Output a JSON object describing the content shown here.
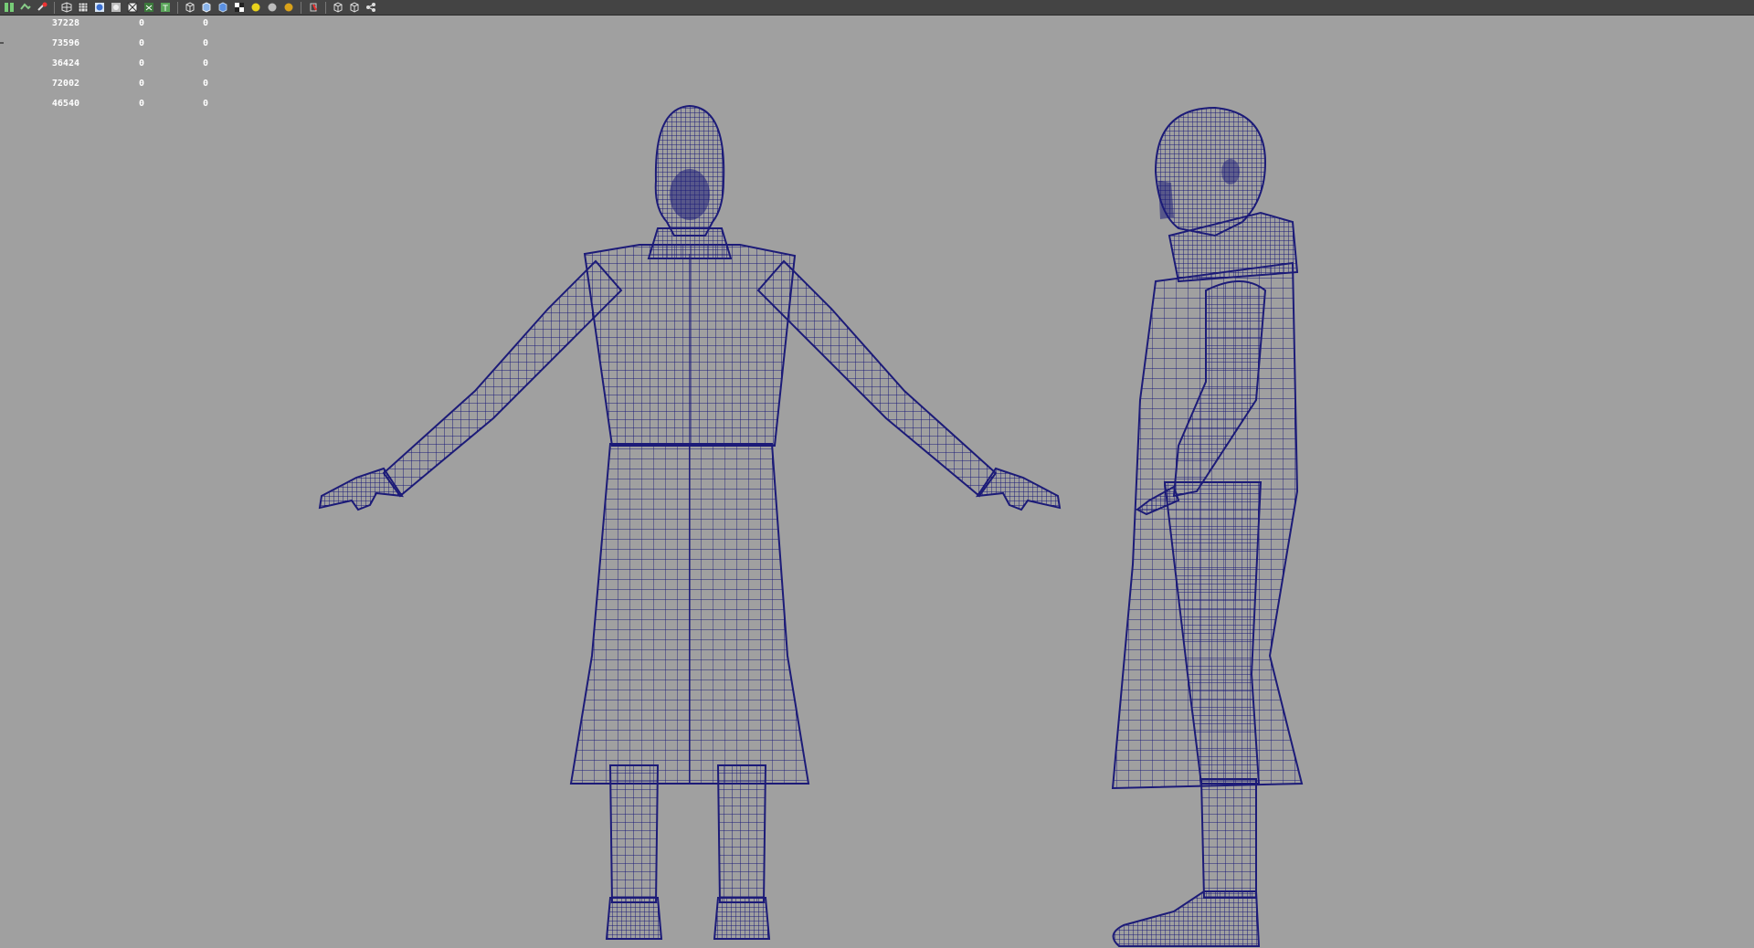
{
  "toolbar": {
    "icons": [
      "panel-layout-icon",
      "camera-icon",
      "object-snap-icon",
      "wireframe-icon",
      "smooth-shade-icon",
      "shaded-sphere-icon",
      "flat-shade-icon",
      "bounding-box-icon",
      "points-icon",
      "texture-icon",
      "cube-wire-icon",
      "cube-shaded-icon",
      "cube-blue-icon",
      "checker-icon",
      "light-yellow-icon",
      "light-grey-icon",
      "light-gold-icon",
      "isolate-select-icon",
      "xray-icon",
      "xray-joints-icon",
      "grid-icon"
    ],
    "separators_after": [
      2,
      9,
      16,
      17
    ]
  },
  "hud": {
    "rows": [
      [
        "37228",
        "0",
        "0"
      ],
      [
        "73596",
        "0",
        "0"
      ],
      [
        "36424",
        "0",
        "0"
      ],
      [
        "72002",
        "0",
        "0"
      ],
      [
        "46540",
        "0",
        "0"
      ]
    ]
  },
  "viewport": {
    "background_color": "#a0a0a0",
    "wire_color": "#1c1b78",
    "models": [
      "front-view-character",
      "side-view-character"
    ]
  }
}
